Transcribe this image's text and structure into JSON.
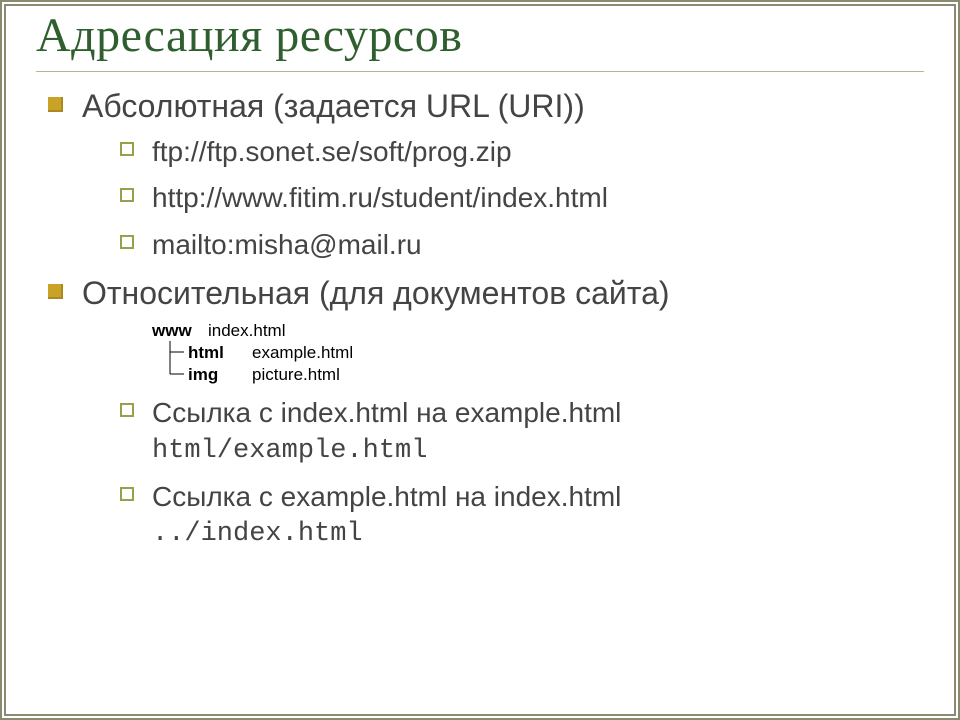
{
  "title": "Адресация ресурсов",
  "bullets": {
    "absolute": {
      "heading": "Абсолютная (задается URL (URI))",
      "items": [
        "ftp://ftp.sonet.se/soft/prog.zip",
        "http://www.fitim.ru/student/index.html",
        "mailto:misha@mail.ru"
      ]
    },
    "relative": {
      "heading": "Относительная (для документов сайта)",
      "tree": {
        "root": {
          "folder": "www",
          "file": "index.html"
        },
        "children": [
          {
            "folder": "html",
            "file": "example.html"
          },
          {
            "folder": "img",
            "file": "picture.html"
          }
        ]
      },
      "links": [
        {
          "text": "Ссылка с index.html на example.html",
          "path": "html/example.html"
        },
        {
          "text": "Ссылка с example.html на index.html",
          "path": "../index.html"
        }
      ]
    }
  }
}
